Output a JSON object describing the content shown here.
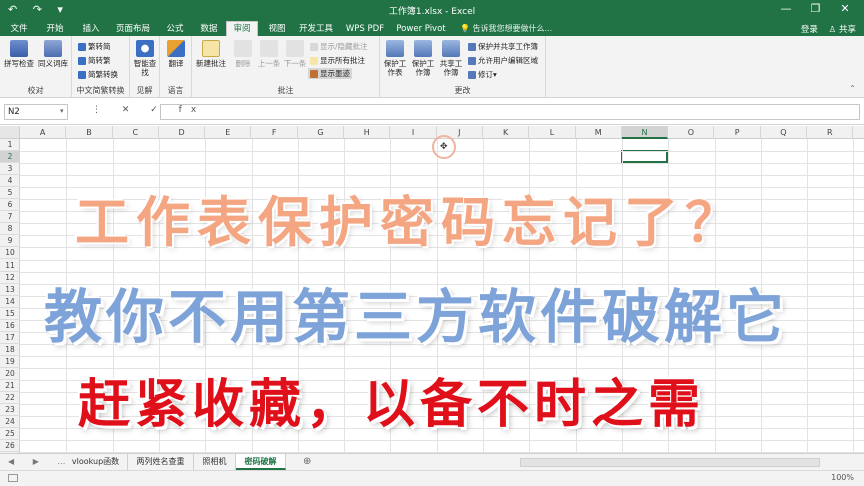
{
  "window": {
    "title": "工作簿1.xlsx - Excel",
    "quick_access": "↶ ↷ ▾",
    "controls": [
      "—",
      "❐",
      "✕"
    ]
  },
  "tabs": [
    {
      "label": "文件"
    },
    {
      "label": "开始"
    },
    {
      "label": "插入"
    },
    {
      "label": "页面布局"
    },
    {
      "label": "公式"
    },
    {
      "label": "数据"
    },
    {
      "label": "审阅",
      "active": true
    },
    {
      "label": "视图"
    },
    {
      "label": "开发工具"
    },
    {
      "label": "WPS PDF"
    },
    {
      "label": "Power Pivot"
    }
  ],
  "tell_me": "告诉我您想要做什么...",
  "account": {
    "login": "登录",
    "share": "共享"
  },
  "ribbon": {
    "groups": {
      "proofing": "校对",
      "chinese": "中文简繁转换",
      "insights": "见解",
      "language": "语言",
      "comments": "批注",
      "changes": "更改"
    },
    "spell_check": "拼写检查",
    "thesaurus": "同义词库",
    "trad_to_simp": "繁转简",
    "simp_to_trad": "简转繁",
    "convert": "简繁转换",
    "smart_lookup": "智能查找",
    "translate": "翻译",
    "new_comment": "新建批注",
    "delete": "删除",
    "previous": "上一条",
    "next": "下一条",
    "show_hide_comment": "显示/隐藏批注",
    "show_all_comments": "显示所有批注",
    "show_ink": "显示墨迹",
    "protect_sheet": "保护工作表",
    "protect_workbook": "保护工作簿",
    "share_workbook": "共享工作簿",
    "protect_share": "保护并共享工作簿",
    "allow_edit_ranges": "允许用户编辑区域",
    "track_changes": "修订"
  },
  "formula_bar": {
    "name_box": "N2",
    "icons": "⋮ ✕ ✓ fx",
    "formula": ""
  },
  "grid": {
    "columns": [
      "A",
      "B",
      "C",
      "D",
      "E",
      "F",
      "G",
      "H",
      "I",
      "J",
      "K",
      "L",
      "M",
      "N",
      "O",
      "P",
      "Q",
      "R"
    ],
    "selected_column": "N",
    "rows": [
      "1",
      "2",
      "3",
      "4",
      "5",
      "6",
      "7",
      "8",
      "9",
      "10",
      "11",
      "12",
      "13",
      "14",
      "15",
      "16",
      "17",
      "18",
      "19",
      "20",
      "21",
      "22",
      "23",
      "24",
      "25",
      "26"
    ],
    "selected_row": "2"
  },
  "overlay": {
    "line1": "工作表保护密码忘记了？",
    "line2": "教你不用第三方软件破解它",
    "line3": "赶紧收藏，以备不时之需"
  },
  "sheets": [
    {
      "label": "vlookup函数"
    },
    {
      "label": "两列姓名查重"
    },
    {
      "label": "照相机"
    },
    {
      "label": "密码破解",
      "active": true
    }
  ],
  "sheet_nav": "◀ ▶ …",
  "add_sheet": "⊕",
  "zoom": "100%"
}
